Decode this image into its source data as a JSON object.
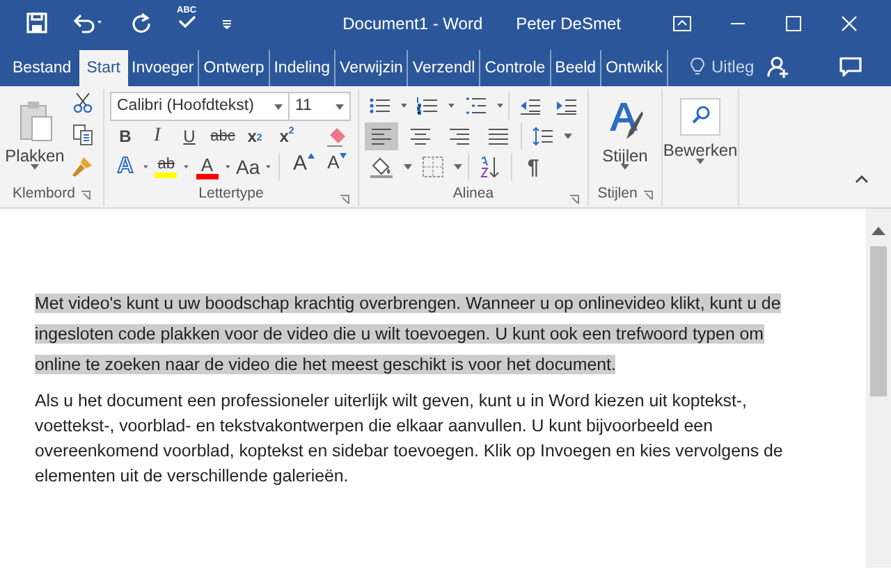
{
  "quick_access": [
    {
      "kind": "save"
    },
    {
      "kind": "undo"
    },
    {
      "kind": "redo"
    },
    {
      "kind": "spelling",
      "label": "ABC"
    },
    {
      "kind": "customize"
    }
  ],
  "window": {
    "title": "Document1 - Word",
    "user": "Peter DeSmet"
  },
  "tabs": [
    {
      "label": "Bestand",
      "selected": false
    },
    {
      "label": "Start",
      "selected": true
    },
    {
      "label": "Invoeger",
      "selected": false
    },
    {
      "label": "Ontwerp",
      "selected": false
    },
    {
      "label": "Indeling",
      "selected": false
    },
    {
      "label": "Verwijzin",
      "selected": false
    },
    {
      "label": "Verzendl",
      "selected": false
    },
    {
      "label": "Controle",
      "selected": false
    },
    {
      "label": "Beeld",
      "selected": false
    },
    {
      "label": "Ontwikk",
      "selected": false
    }
  ],
  "tell_me": "Uitleg",
  "clipboard": {
    "paste": "Plakken",
    "group": "Klembord"
  },
  "font": {
    "name": "Calibri (Hoofdtekst)",
    "size": "11",
    "group": "Lettertype",
    "format_buttons": [
      {
        "kind": "bold",
        "label": "B"
      },
      {
        "kind": "italic",
        "label": "I"
      },
      {
        "kind": "underline",
        "label": "U"
      },
      {
        "kind": "strike",
        "label": "abc"
      },
      {
        "kind": "sub",
        "label": "x",
        "script": "2"
      },
      {
        "kind": "sup",
        "label": "x",
        "script": "2"
      }
    ],
    "effect_buttons": [
      {
        "kind": "effects",
        "label": "A"
      },
      {
        "kind": "highlight",
        "label": "ab",
        "color": "#ffff00"
      },
      {
        "kind": "fontcolor",
        "label": "A",
        "color": "#ff0000"
      },
      {
        "kind": "case",
        "label": "Aa"
      }
    ],
    "size_buttons": [
      {
        "kind": "grow",
        "label": "A"
      },
      {
        "kind": "shrink",
        "label": "A"
      }
    ]
  },
  "paragraph": {
    "group": "Alinea",
    "pilcrow": "¶",
    "alignment": [
      {
        "kind": "left",
        "selected": true
      },
      {
        "kind": "center",
        "selected": false
      },
      {
        "kind": "right",
        "selected": false
      },
      {
        "kind": "justify",
        "selected": false
      }
    ]
  },
  "styles": {
    "label": "Stijlen",
    "group": "Stijlen"
  },
  "editing": {
    "label": "Bewerken"
  },
  "document": {
    "paragraphs": [
      {
        "selected": true,
        "lines": [
          "Met video's kunt u uw boodschap krachtig overbrengen. Wanneer u op onlinevideo klikt, kunt u de",
          "ingesloten code plakken voor de video die u wilt toevoegen. U kunt ook een trefwoord typen om",
          "online te zoeken naar de video die het meest geschikt is voor het document."
        ]
      },
      {
        "selected": false,
        "lines": [
          "Als u het document een professioneler uiterlijk wilt geven, kunt u in Word kiezen uit koptekst-,",
          "voettekst-, voorblad- en tekstvakontwerpen die elkaar aanvullen. U kunt bijvoorbeeld een",
          "overeenkomend voorblad, koptekst en sidebar toevoegen. Klik op Invoegen en kies vervolgens de",
          "elementen uit de verschillende galerieën."
        ]
      }
    ]
  }
}
